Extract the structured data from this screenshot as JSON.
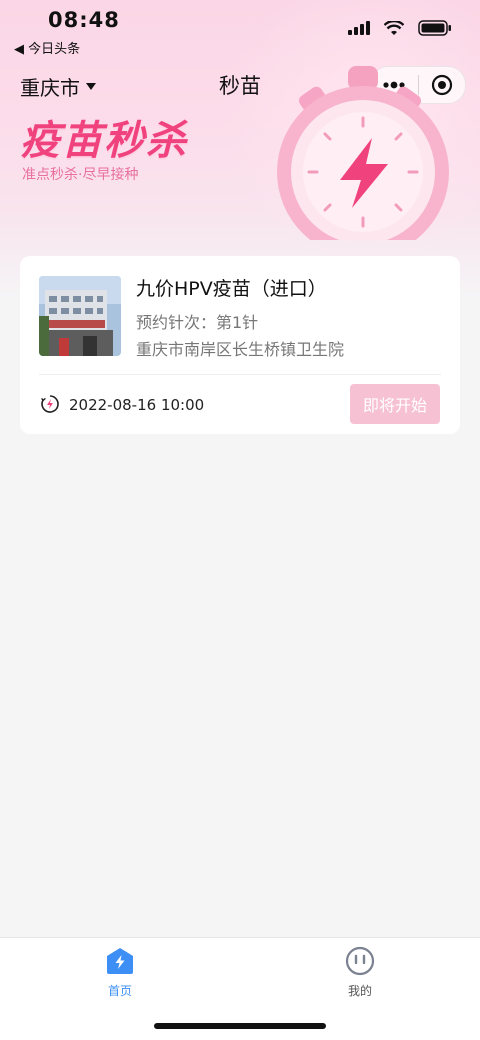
{
  "status_bar": {
    "time": "08:48",
    "back_app": "◀ 今日头条"
  },
  "nav": {
    "city": "重庆市",
    "title": "秒苗"
  },
  "banner": {
    "title": "疫苗秒杀",
    "subtitle": "准点秒杀·尽早接种"
  },
  "card": {
    "vaccine_name": "九价HPV疫苗（进口）",
    "dose": "预约针次：第1针",
    "hospital": "重庆市南岸区长生桥镇卫生院",
    "datetime": "2022-08-16 10:00",
    "button": "即将开始"
  },
  "tabbar": {
    "home": "首页",
    "mine": "我的",
    "active": "home"
  },
  "colors": {
    "accent_pink": "#f0437e",
    "tab_active": "#3d8ff5",
    "button_disabled": "#f7c1d4"
  },
  "icons": [
    "signal-icon",
    "wifi-icon",
    "battery-icon",
    "more-icon",
    "target-icon",
    "stopwatch-icon",
    "clock-bolt-icon",
    "home-bolt-icon",
    "mine-face-icon"
  ]
}
